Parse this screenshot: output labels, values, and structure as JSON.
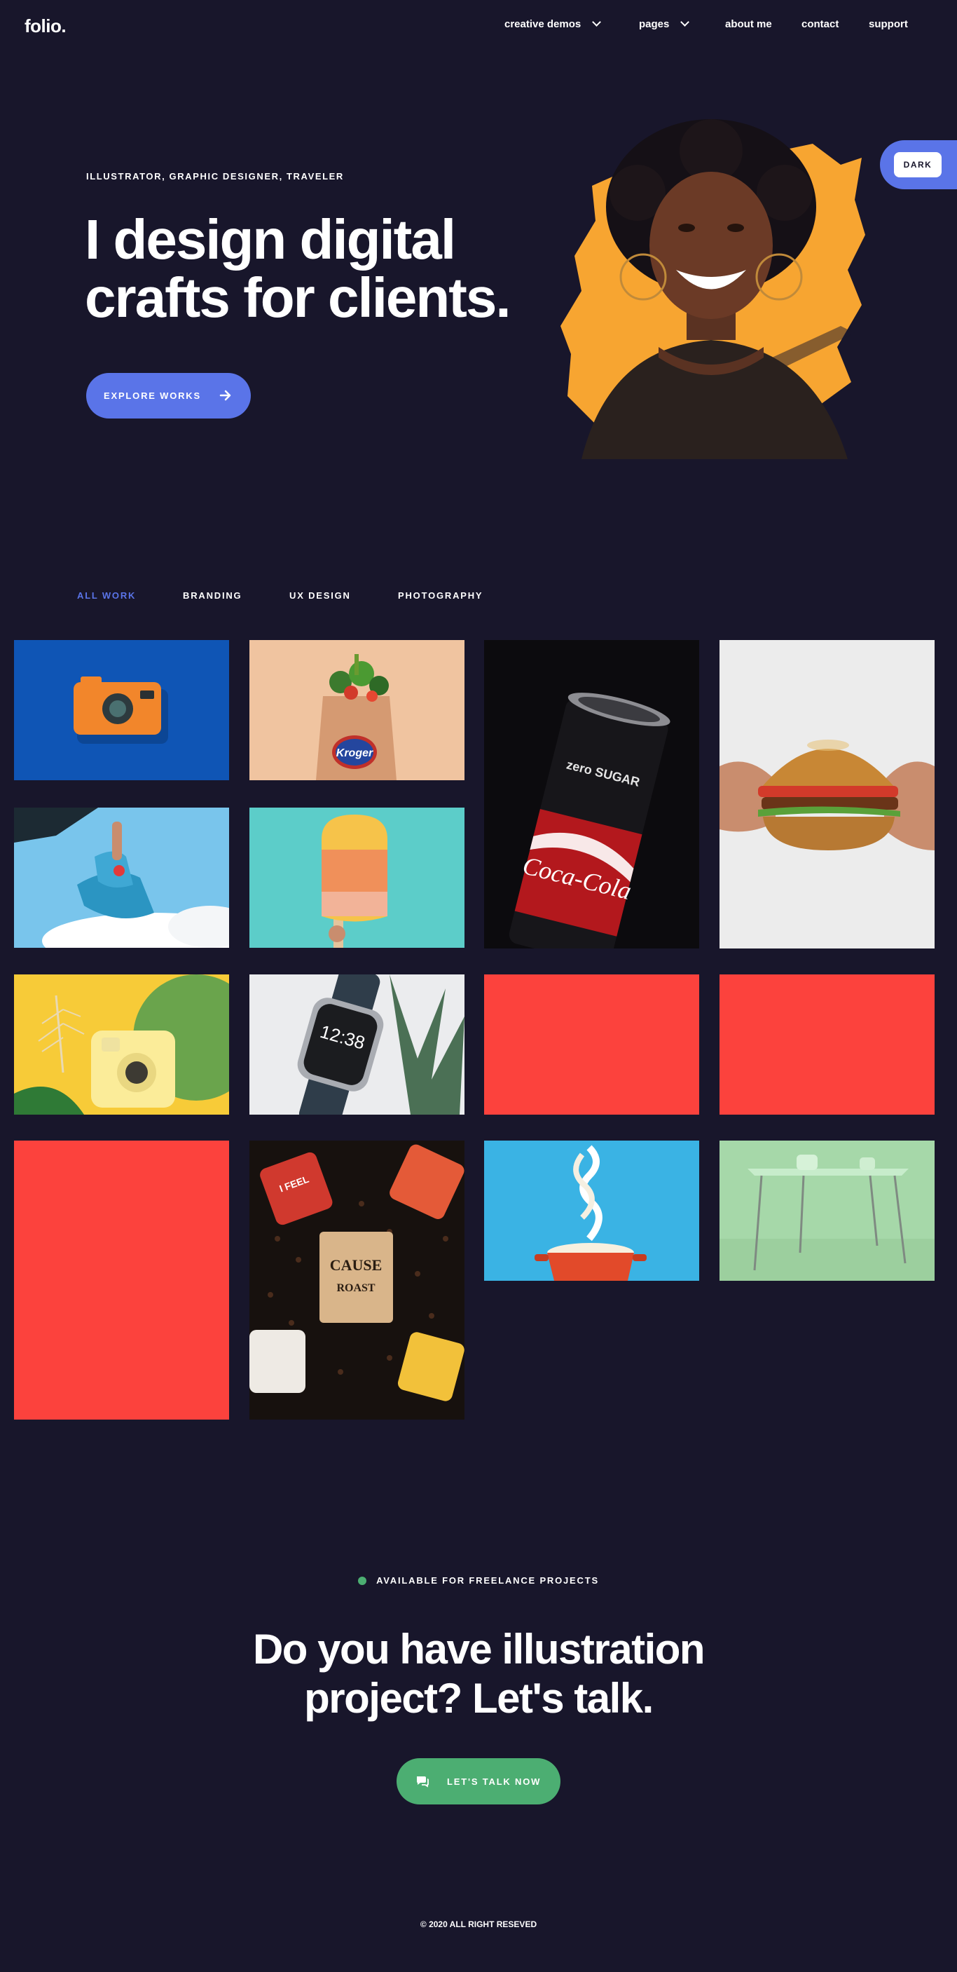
{
  "brand": {
    "logo": "folio."
  },
  "nav": {
    "items": [
      {
        "label": "creative demos",
        "has_dropdown": true
      },
      {
        "label": "pages",
        "has_dropdown": true
      },
      {
        "label": "about me",
        "has_dropdown": false
      },
      {
        "label": "contact",
        "has_dropdown": false
      },
      {
        "label": "support",
        "has_dropdown": false
      }
    ]
  },
  "theme_toggle": {
    "label": "DARK"
  },
  "hero": {
    "kicker": "ILLUSTRATOR, GRAPHIC DESIGNER, TRAVELER",
    "title_line1": "I design digital",
    "title_line2": "crafts for clients.",
    "button_label": "EXPLORE WORKS",
    "button_icon": "arrow-right-icon",
    "portrait_accent": "#f7a531"
  },
  "portfolio": {
    "filters": [
      {
        "label": "ALL WORK",
        "active": true
      },
      {
        "label": "BRANDING",
        "active": false
      },
      {
        "label": "UX DESIGN",
        "active": false
      },
      {
        "label": "PHOTOGRAPHY",
        "active": false
      }
    ],
    "items": [
      {
        "subject": "orange-camera"
      },
      {
        "subject": "kroger-grocery-bag",
        "label": "Kroger"
      },
      {
        "subject": "coca-cola-can",
        "label": "Coca-Cola",
        "can_text": "zero SUGAR"
      },
      {
        "subject": "burger-in-hands"
      },
      {
        "subject": "blue-sneakers"
      },
      {
        "subject": "popsicle"
      },
      {
        "subject": "instax-camera"
      },
      {
        "subject": "smartwatch",
        "time": "12:38"
      },
      {
        "subject": "red-placeholder"
      },
      {
        "subject": "red-placeholder"
      },
      {
        "subject": "red-placeholder"
      },
      {
        "subject": "coffee-mugs",
        "label_line1": "CAUSE",
        "label_line2": "ROAST"
      },
      {
        "subject": "noodle-pot"
      },
      {
        "subject": "green-table"
      }
    ]
  },
  "cta": {
    "availability": "AVAILABLE FOR FREELANCE PROJECTS",
    "title_line1": "Do you have illustration",
    "title_line2": "project? Let's talk.",
    "button_label": "LET'S TALK NOW",
    "button_icon": "chat-icon"
  },
  "footer": {
    "copyright": "© 2020 ALL RIGHT RESEVED"
  },
  "colors": {
    "background": "#18162b",
    "accent_blue": "#5a74e8",
    "accent_green": "#4cae72",
    "tile_red": "#fc423d"
  }
}
